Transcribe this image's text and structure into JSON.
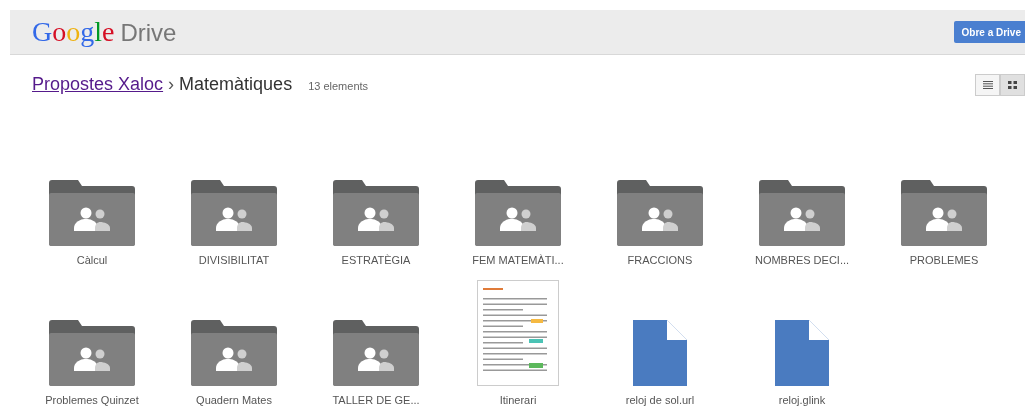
{
  "header": {
    "logo": "Google",
    "product": "Drive",
    "open_button": "Obre a Drive"
  },
  "breadcrumb": {
    "parent": "Propostes Xaloc",
    "separator": "›",
    "current": "Matemàtiques",
    "count": "13 elements"
  },
  "view_toggle": [
    {
      "kind": "list",
      "selected": false
    },
    {
      "kind": "grid",
      "selected": true
    }
  ],
  "items": [
    {
      "kind": "folder",
      "name": "Càlcul"
    },
    {
      "kind": "folder",
      "name": "DIVISIBILITAT"
    },
    {
      "kind": "folder",
      "name": "ESTRATÈGIA"
    },
    {
      "kind": "folder",
      "name": "FEM MATEMÀTI..."
    },
    {
      "kind": "folder",
      "name": "FRACCIONS"
    },
    {
      "kind": "folder",
      "name": "NOMBRES DECI..."
    },
    {
      "kind": "folder",
      "name": "PROBLEMES"
    },
    {
      "kind": "folder",
      "name": "Problemes Quinzet"
    },
    {
      "kind": "folder",
      "name": "Quadern Mates"
    },
    {
      "kind": "folder",
      "name": "TALLER DE GE..."
    },
    {
      "kind": "document",
      "name": "Itinerari"
    },
    {
      "kind": "file",
      "name": "reloj de sol.url"
    },
    {
      "kind": "file",
      "name": "reloj.glink"
    }
  ]
}
